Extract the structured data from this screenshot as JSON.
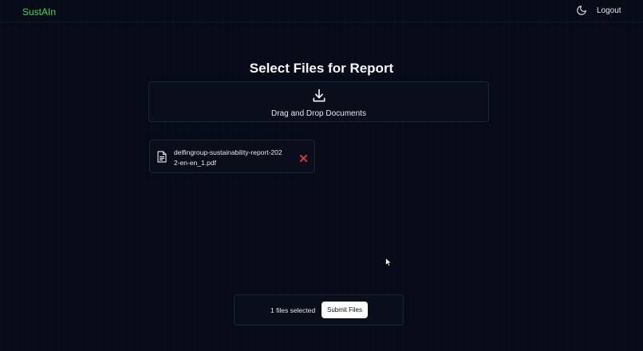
{
  "header": {
    "brand": "SustAIn",
    "theme_icon": "moon-icon",
    "logout_label": "Logout"
  },
  "main": {
    "title": "Select Files for Report",
    "dropzone": {
      "icon": "download-icon",
      "label": "Drag and Drop Documents"
    },
    "files": [
      {
        "name": "delfingroup-sustainability-report-2022-en-en_1.pdf",
        "icon": "document-icon",
        "remove_icon": "close-icon"
      }
    ]
  },
  "footer": {
    "status_text": "1 files selected",
    "submit_label": "Submit Files"
  },
  "colors": {
    "background": "#070b17",
    "brand": "#3ddc56",
    "remove": "#d9343f",
    "button_bg": "#ffffff"
  }
}
